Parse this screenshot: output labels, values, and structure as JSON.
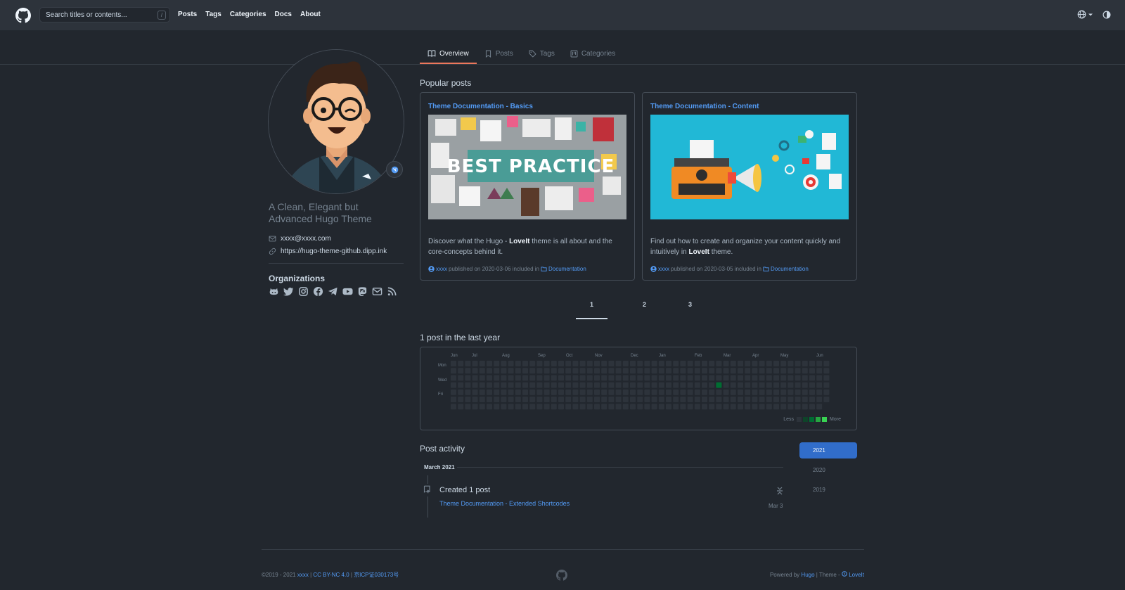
{
  "header": {
    "search_placeholder": "Search titles or contents...",
    "search_shortcut": "/",
    "nav": [
      "Posts",
      "Tags",
      "Categories",
      "Docs",
      "About"
    ]
  },
  "tabs": [
    {
      "label": "Overview",
      "icon": "book-icon",
      "active": true
    },
    {
      "label": "Posts",
      "icon": "bookmark-icon",
      "active": false
    },
    {
      "label": "Tags",
      "icon": "tag-icon",
      "active": false
    },
    {
      "label": "Categories",
      "icon": "project-icon",
      "active": false
    }
  ],
  "profile": {
    "bio": "A Clean, Elegant but Advanced Hugo Theme",
    "email": "xxxx@xxxx.com",
    "website": "https://hugo-theme-github.dipp.ink",
    "organizations_title": "Organizations",
    "socials": [
      "github-icon",
      "twitter-icon",
      "instagram-icon",
      "facebook-icon",
      "telegram-icon",
      "youtube-icon",
      "mastodon-icon",
      "mail-icon",
      "rss-icon"
    ]
  },
  "popular": {
    "title": "Popular posts",
    "posts": [
      {
        "title": "Theme Documentation - Basics",
        "image_text": "BEST PRACTICE",
        "desc_pre": "Discover what the Hugo - ",
        "desc_bold": "LoveIt",
        "desc_post": " theme is all about and the core-concepts behind it.",
        "author": "xxxx",
        "published": "published on 2020-03-06 included in",
        "category": "Documentation"
      },
      {
        "title": "Theme Documentation - Content",
        "image_text": "",
        "desc_pre": "Find out how to create and organize your content quickly and intuitively in ",
        "desc_bold": "LoveIt",
        "desc_post": " theme.",
        "author": "xxxx",
        "published": "published on 2020-03-05 included in",
        "category": "Documentation"
      }
    ]
  },
  "pagination": [
    "1",
    "2",
    "3"
  ],
  "contributions": {
    "title": "1 post in the last year",
    "months": [
      "Jun",
      "Jul",
      "Aug",
      "Sep",
      "Oct",
      "Nov",
      "Dec",
      "Jan",
      "Feb",
      "Mar",
      "Apr",
      "May",
      "Jun"
    ],
    "days": [
      "Mon",
      "Wed",
      "Fri"
    ],
    "legend_less": "Less",
    "legend_more": "More",
    "colors": [
      "#2d333b",
      "#0e4429",
      "#006d32",
      "#26a641",
      "#39d353"
    ]
  },
  "activity": {
    "title": "Post activity",
    "years": [
      "2021",
      "2020",
      "2019"
    ],
    "month": "March 2021",
    "created": "Created 1 post",
    "post_link": "Theme Documentation - Extended Shortcodes",
    "date": "Mar 3"
  },
  "footer": {
    "copyright": "©2019 - 2021",
    "author": "xxxx",
    "license": "CC BY-NC 4.0",
    "icp": "京ICP证030173号",
    "powered_by": "Powered by",
    "hugo": "Hugo",
    "theme": "| Theme -",
    "theme_name": "LoveIt"
  }
}
